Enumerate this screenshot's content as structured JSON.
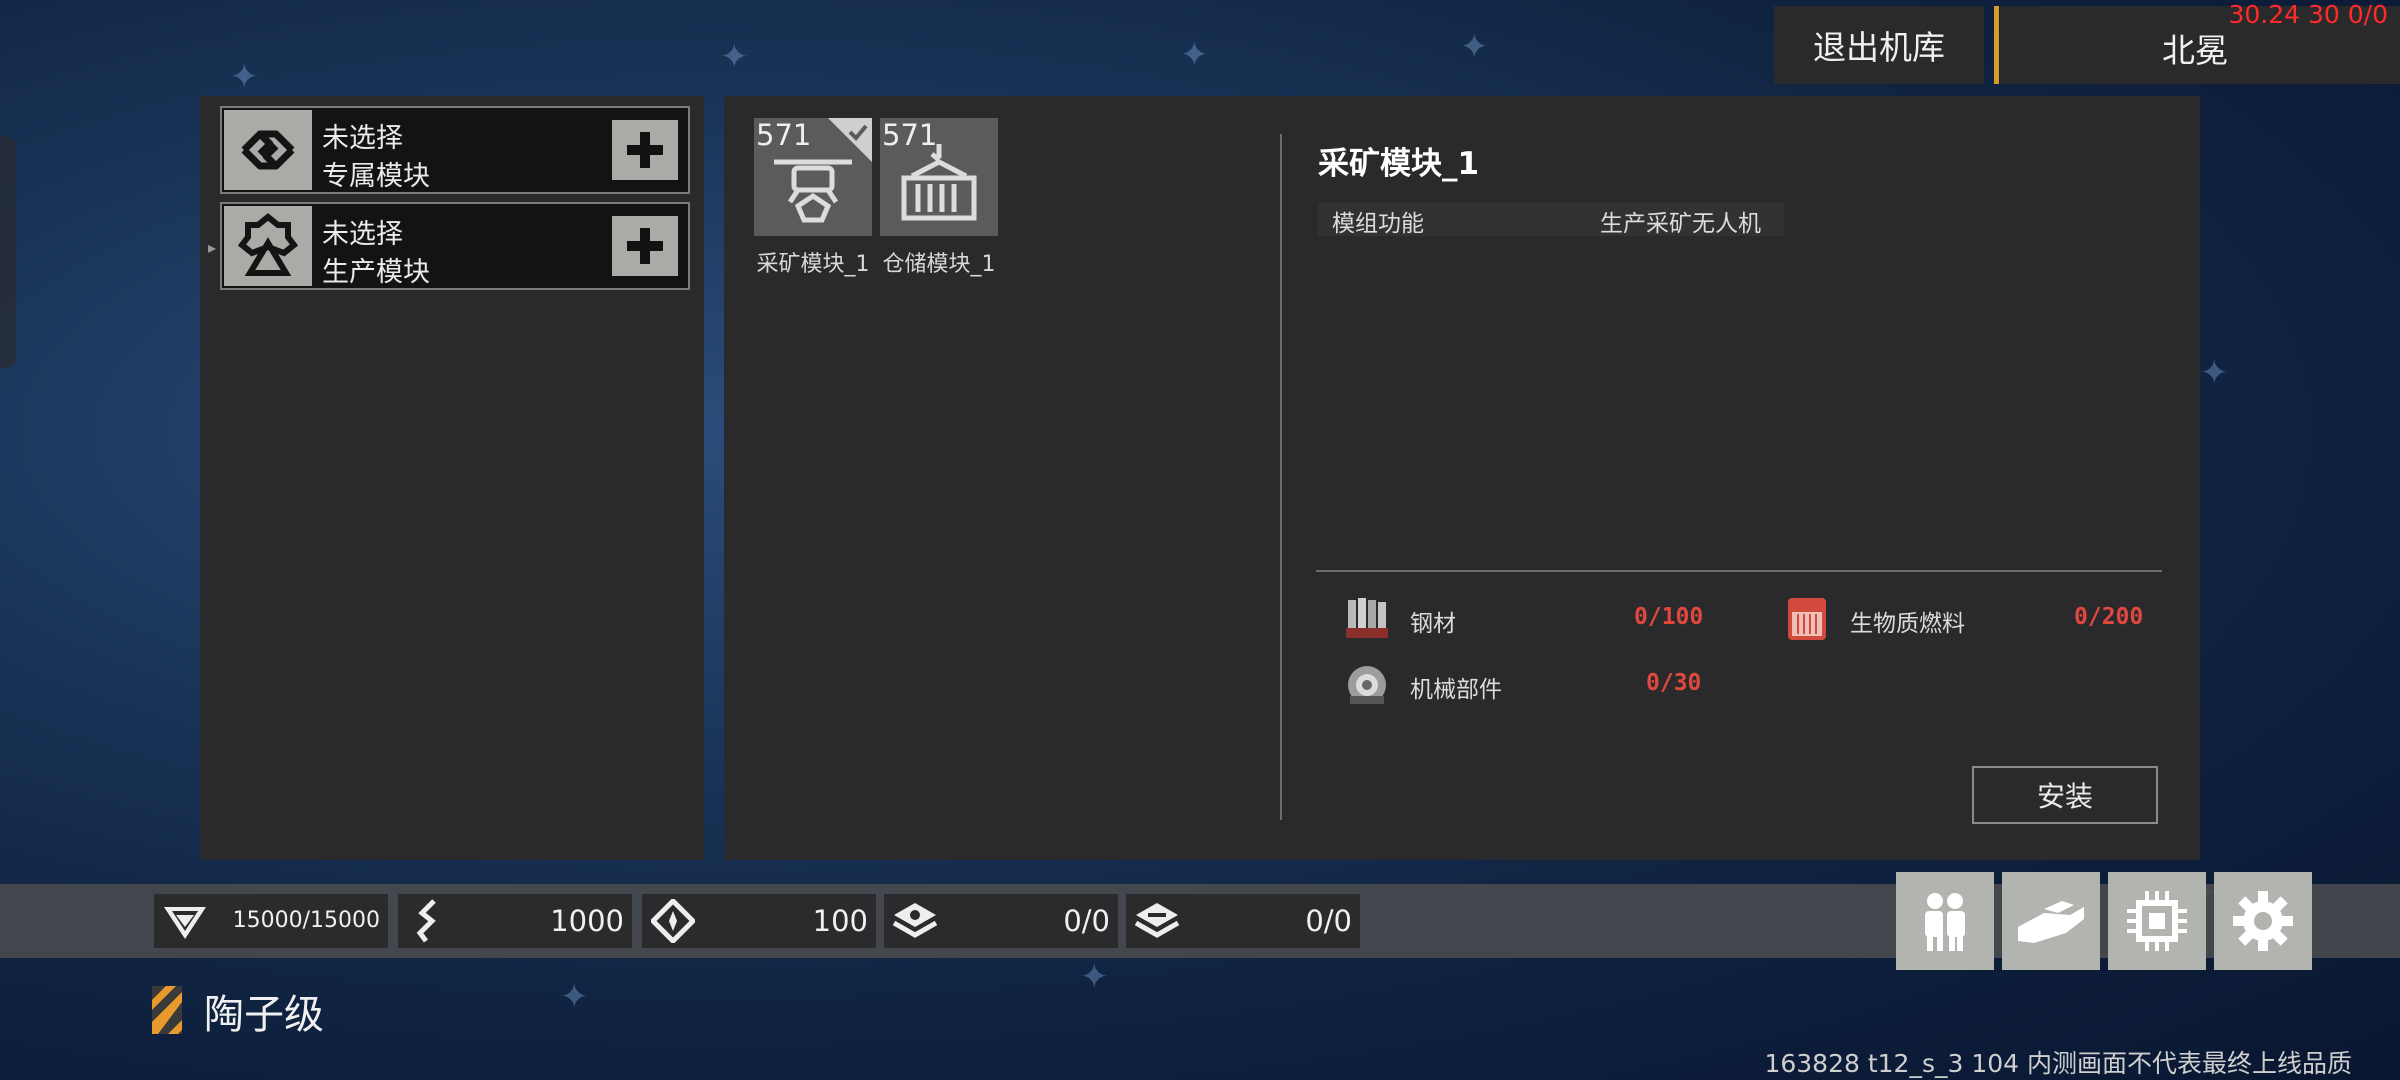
{
  "topbar": {
    "exit_label": "退出机库",
    "location": "北冕",
    "debug": "30.24 30 0/0"
  },
  "slots": [
    {
      "line1": "未选择",
      "line2": "专属模块",
      "icon": "link-emblem-icon",
      "add_icon": "plus-icon"
    },
    {
      "line1": "未选择",
      "line2": "生产模块",
      "icon": "gear-emblem-icon",
      "add_icon": "plus-icon"
    }
  ],
  "modules": [
    {
      "count": "571",
      "label": "采矿模块_1",
      "icon": "mining-drone-icon",
      "selected": true
    },
    {
      "count": "571",
      "label": "仓储模块_1",
      "icon": "cargo-container-icon",
      "selected": false
    }
  ],
  "detail": {
    "title": "采矿模块_1",
    "prop_key": "模组功能",
    "prop_value": "生产采矿无人机",
    "materials": [
      {
        "name": "钢材",
        "qty": "0/100",
        "icon": "steel-icon"
      },
      {
        "name": "生物质燃料",
        "qty": "0/200",
        "icon": "biofuel-icon"
      },
      {
        "name": "机械部件",
        "qty": "0/30",
        "icon": "mech-parts-icon"
      }
    ],
    "install_label": "安装"
  },
  "stats": [
    {
      "icon": "hull-icon",
      "value": "15000/15000"
    },
    {
      "icon": "speed-icon",
      "value": "1000"
    },
    {
      "icon": "nav-icon",
      "value": "100"
    },
    {
      "icon": "layer-slot-icon",
      "value": "0/0"
    },
    {
      "icon": "layer-stack-icon",
      "value": "0/0"
    }
  ],
  "actions": [
    "crew-icon",
    "hangar-hand-icon",
    "chip-icon",
    "settings-gear-icon"
  ],
  "tier": {
    "label": "陶子级"
  },
  "build_info": "163828 t12_s_3 104  内测画面不代表最终上线品质",
  "colors": {
    "accent": "#d89c2a",
    "warning": "#e0483f"
  }
}
